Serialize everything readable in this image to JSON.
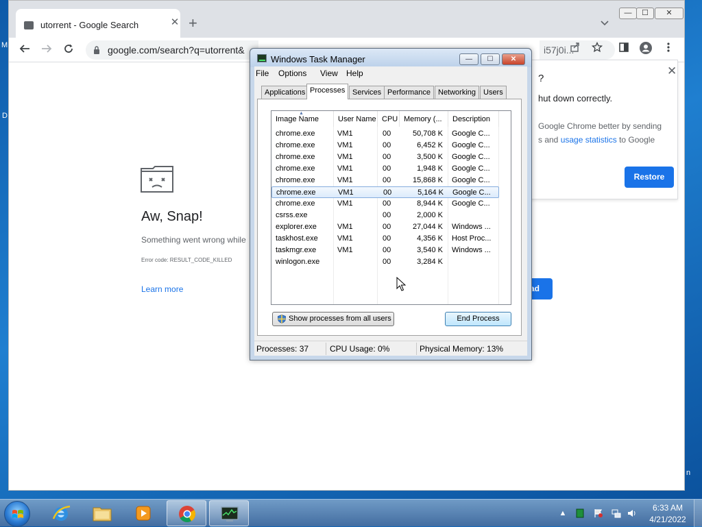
{
  "desktop": {
    "glyph_a": "M",
    "glyph_b": "D",
    "glyph_c": "n"
  },
  "chrome": {
    "tab_title": "utorrent - Google Search",
    "tab_close": "✕",
    "new_tab": "+",
    "url": "google.com/search?q=utorrent&",
    "url_tail": "i57j0i...",
    "window_controls": {
      "minimize": "—",
      "maximize": "☐",
      "close": "✕"
    },
    "error": {
      "title": "Aw, Snap!",
      "message": "Something went wrong while",
      "code": "Error code: RESULT_CODE_KILLED",
      "learn_more": "Learn more",
      "reload_fragment": "ad"
    },
    "restore": {
      "question_fragment": "?",
      "line1": "hut down correctly.",
      "line2": "Google Chrome better by sending",
      "line3_prefix": "s and ",
      "line3_link": "usage statistics",
      "line3_suffix": " to Google",
      "button": "Restore"
    }
  },
  "taskmanager": {
    "title": "Windows Task Manager",
    "menu": [
      "File",
      "Options",
      "View",
      "Help"
    ],
    "tabs": [
      "Applications",
      "Processes",
      "Services",
      "Performance",
      "Networking",
      "Users"
    ],
    "active_tab": "Processes",
    "columns": [
      "Image Name",
      "User Name",
      "CPU",
      "Memory (...",
      "Description"
    ],
    "rows": [
      {
        "name": "chrome.exe",
        "user": "VM1",
        "cpu": "00",
        "mem": "50,708 K",
        "desc": "Google C..."
      },
      {
        "name": "chrome.exe",
        "user": "VM1",
        "cpu": "00",
        "mem": "6,452 K",
        "desc": "Google C..."
      },
      {
        "name": "chrome.exe",
        "user": "VM1",
        "cpu": "00",
        "mem": "3,500 K",
        "desc": "Google C..."
      },
      {
        "name": "chrome.exe",
        "user": "VM1",
        "cpu": "00",
        "mem": "1,948 K",
        "desc": "Google C..."
      },
      {
        "name": "chrome.exe",
        "user": "VM1",
        "cpu": "00",
        "mem": "15,868 K",
        "desc": "Google C..."
      },
      {
        "name": "chrome.exe",
        "user": "VM1",
        "cpu": "00",
        "mem": "5,164 K",
        "desc": "Google C..."
      },
      {
        "name": "chrome.exe",
        "user": "VM1",
        "cpu": "00",
        "mem": "8,944 K",
        "desc": "Google C..."
      },
      {
        "name": "csrss.exe",
        "user": "",
        "cpu": "00",
        "mem": "2,000 K",
        "desc": ""
      },
      {
        "name": "explorer.exe",
        "user": "VM1",
        "cpu": "00",
        "mem": "27,044 K",
        "desc": "Windows ..."
      },
      {
        "name": "taskhost.exe",
        "user": "VM1",
        "cpu": "00",
        "mem": "4,356 K",
        "desc": "Host Proc..."
      },
      {
        "name": "taskmgr.exe",
        "user": "VM1",
        "cpu": "00",
        "mem": "3,540 K",
        "desc": "Windows ..."
      },
      {
        "name": "winlogon.exe",
        "user": "",
        "cpu": "00",
        "mem": "3,284 K",
        "desc": ""
      }
    ],
    "selected_row": 5,
    "show_all_button": "Show processes from all users",
    "end_process_button": "End Process",
    "status": {
      "processes": "Processes: 37",
      "cpu": "CPU Usage: 0%",
      "memory": "Physical Memory: 13%"
    }
  },
  "taskbar": {
    "time": "6:33 AM",
    "date": "4/21/2022",
    "tray_arrow": "▲"
  }
}
